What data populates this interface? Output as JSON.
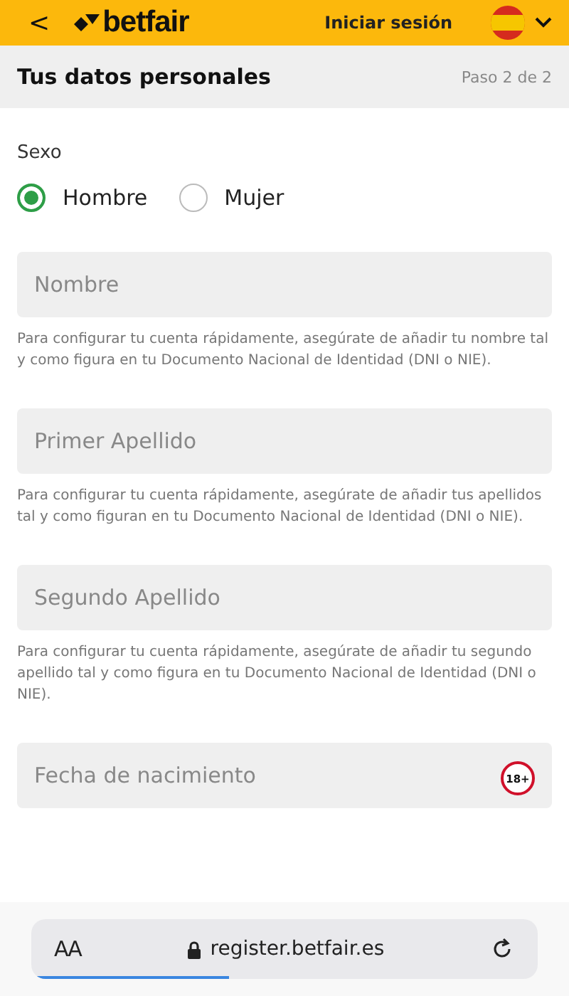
{
  "header": {
    "back": "<",
    "logo": "betfair",
    "login": "Iniciar sesión"
  },
  "page": {
    "title": "Tus datos personales",
    "step": "Paso 2 de 2"
  },
  "sex": {
    "label": "Sexo",
    "options": [
      {
        "label": "Hombre",
        "selected": true
      },
      {
        "label": "Mujer",
        "selected": false
      }
    ]
  },
  "fields": [
    {
      "kind": "text",
      "placeholder": "Nombre",
      "help": "Para configurar tu cuenta rápidamente, asegúrate de añadir tu nombre tal y como figura en tu Documento Nacional de Identidad (DNI o NIE)."
    },
    {
      "kind": "text",
      "placeholder": "Primer Apellido",
      "help": "Para configurar tu cuenta rápidamente, asegúrate de añadir tus apellidos tal y como figuran en tu Documento Nacional de Identidad (DNI o NIE)."
    },
    {
      "kind": "text",
      "placeholder": "Segundo Apellido",
      "help": "Para configurar tu cuenta rápidamente, asegúrate de añadir tu segundo apellido tal y como figura en tu Documento Nacional de Identidad (DNI o NIE)."
    },
    {
      "kind": "date",
      "placeholder": "Fecha de nacimiento",
      "badge": "18+"
    }
  ],
  "browser": {
    "text_size": "AA",
    "url": "register.betfair.es",
    "level": 0.38
  }
}
